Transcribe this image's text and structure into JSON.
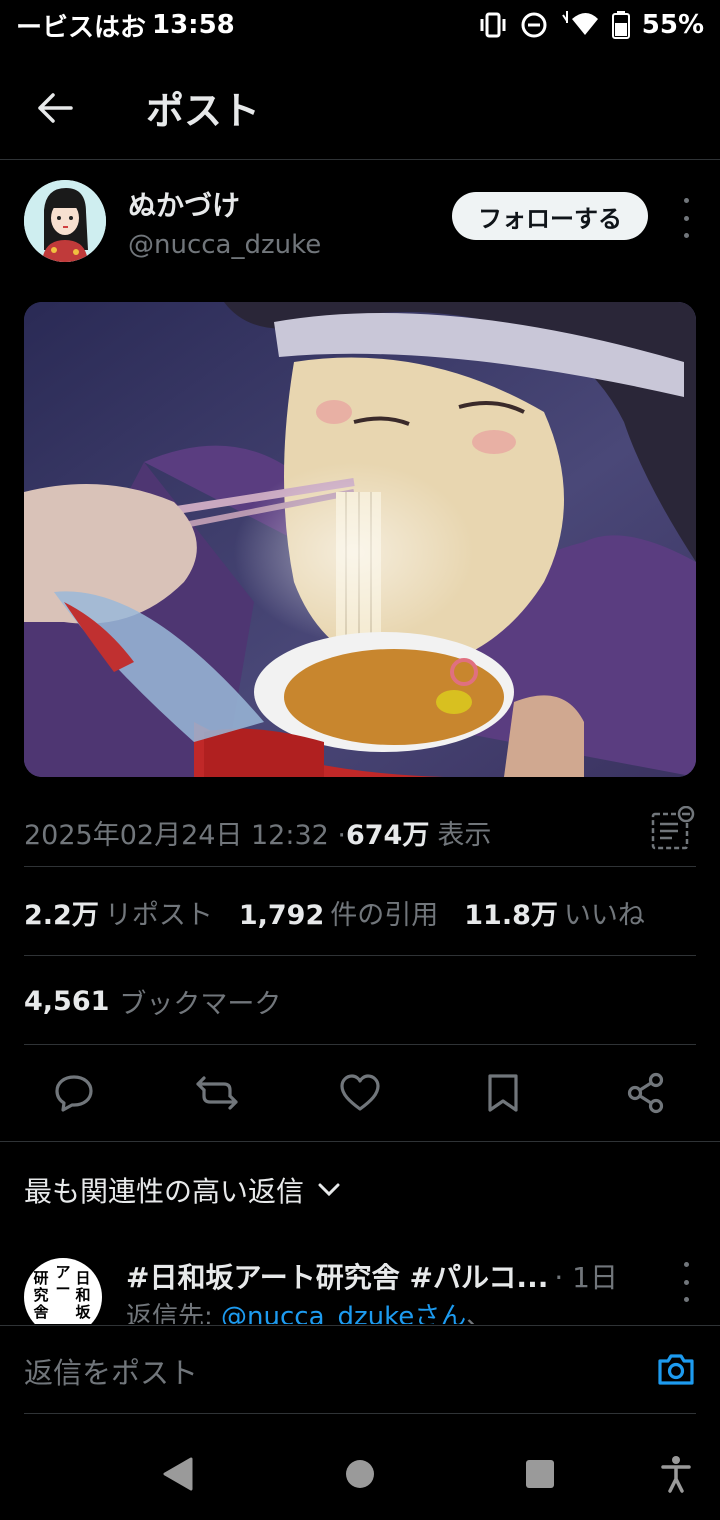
{
  "status_bar": {
    "carrier": "ービスはお",
    "time": "13:58",
    "battery": "55%"
  },
  "header": {
    "title": "ポスト"
  },
  "post": {
    "author": {
      "display_name": "ぬかづけ",
      "handle": "@nucca_dzuke"
    },
    "follow_label": "フォローする",
    "timestamp": "2025年02月24日 12:32 · ",
    "views_count": "674万",
    "views_label": "表示",
    "stats": {
      "reposts_count": "2.2万",
      "reposts_label": "リポスト",
      "quotes_count": "1,792",
      "quotes_label": "件の引用",
      "likes_count": "11.8万",
      "likes_label": "いいね",
      "bookmarks_count": "4,561",
      "bookmarks_label": "ブックマーク"
    },
    "actions": [
      "reply-icon",
      "repost-icon",
      "like-icon",
      "bookmark-icon",
      "share-icon"
    ]
  },
  "replies": {
    "sort_label": "最も関連性の高い返信",
    "items": [
      {
        "avatar_text_left": "研究舎",
        "avatar_text_mid": "アー",
        "avatar_text_right": "日和坂",
        "name": "#日和坂アート研究舎 #パルコ...",
        "time": "· 1日",
        "reply_to_label": "返信先: ",
        "reply_to_handle": "@nucca_dzukeさん",
        "reply_to_suffix": "、"
      }
    ]
  },
  "composer": {
    "placeholder": "返信をポスト"
  },
  "colors": {
    "background": "#000000",
    "text_primary": "#e7e9ea",
    "text_secondary": "#71767b",
    "accent": "#1d9bf0",
    "divider": "#2f3336"
  }
}
